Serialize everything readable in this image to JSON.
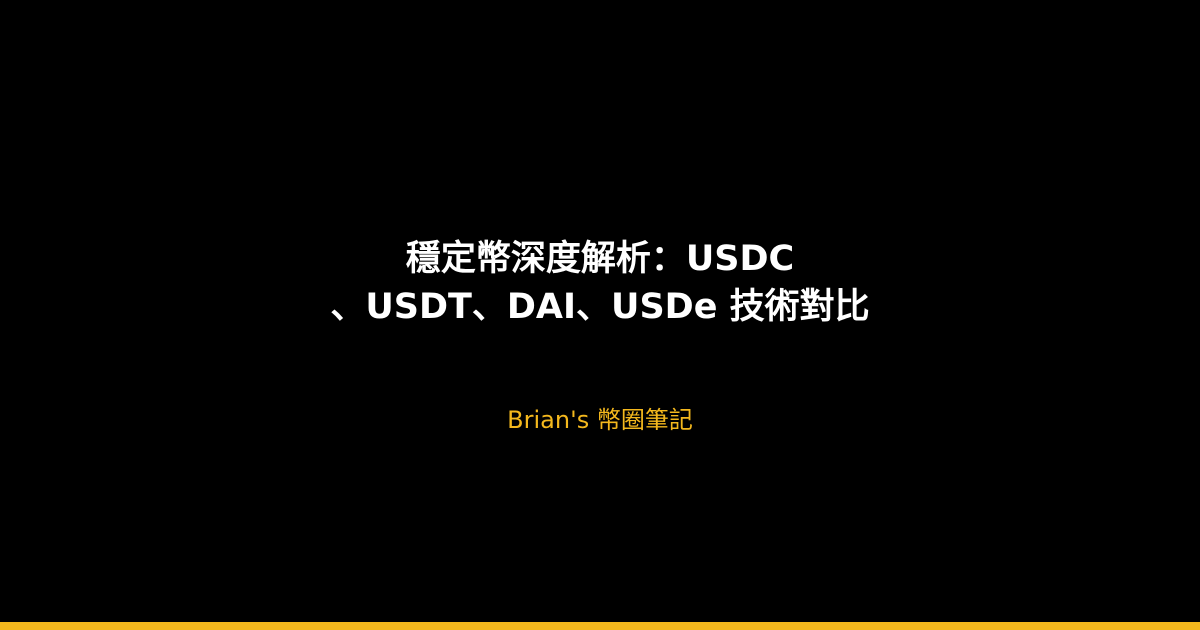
{
  "card": {
    "title_line_1": "穩定幣深度解析：USDC",
    "title_line_2": "、USDT、DAI、USDe 技術對比",
    "author": "Brian's 幣圈筆記"
  },
  "colors": {
    "background": "#000000",
    "title_text": "#ffffff",
    "accent": "#f4b81d"
  }
}
